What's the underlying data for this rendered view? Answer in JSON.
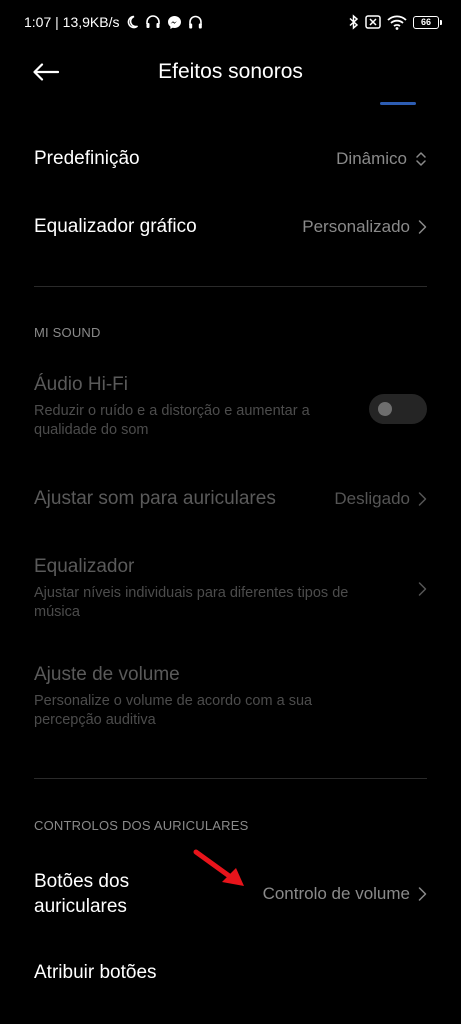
{
  "status_bar": {
    "time_speed": "1:07 | 13,9KB/s",
    "battery": "66",
    "icons": [
      "moon-icon",
      "headset-icon",
      "messenger-icon",
      "headphones-icon",
      "bluetooth-icon",
      "no-sim-icon",
      "wifi-icon",
      "battery-icon"
    ]
  },
  "header": {
    "title": "Efeitos sonoros",
    "back_icon": "back-arrow-icon"
  },
  "rows": {
    "preset": {
      "title": "Predefinição",
      "value": "Dinâmico"
    },
    "graphic_eq": {
      "title": "Equalizador gráfico",
      "value": "Personalizado"
    },
    "hifi": {
      "title": "Áudio Hi-Fi",
      "subtitle": "Reduzir o ruído e a distorção e aumentar a qualidade do som",
      "toggle_on": false
    },
    "adjust_headphones": {
      "title": "Ajustar som para auriculares",
      "value": "Desligado"
    },
    "equalizer": {
      "title": "Equalizador",
      "subtitle": "Ajustar níveis individuais para diferentes tipos de música"
    },
    "volume_adjust": {
      "title": "Ajuste de volume",
      "subtitle": "Personalize o volume de acordo com a sua percepção auditiva"
    },
    "headphone_buttons": {
      "title": "Botões dos auriculares",
      "value": "Controlo de volume"
    },
    "assign_buttons": {
      "title": "Atribuir botões"
    }
  },
  "sections": {
    "mi_sound": "MI SOUND",
    "headphone_controls": "CONTROLOS DOS AURICULARES"
  },
  "colors": {
    "background": "#000000",
    "accent": "#2d5db3",
    "annotation_arrow": "#e8141b"
  }
}
